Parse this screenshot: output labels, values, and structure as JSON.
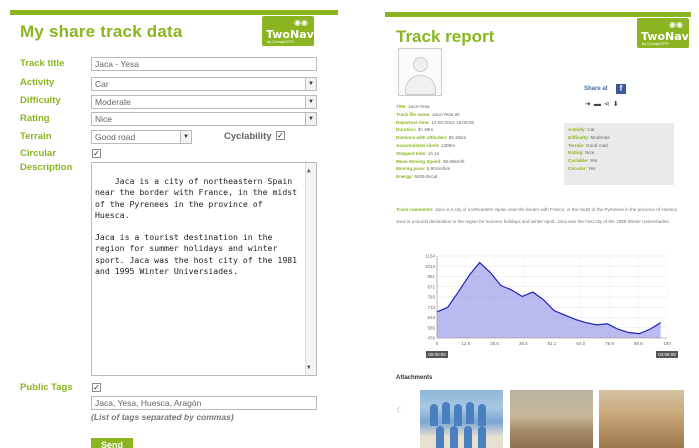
{
  "form": {
    "title": "My share track data",
    "logo": {
      "word": "TwoNav",
      "sub": "by CompeGPS"
    },
    "labels": {
      "track_title": "Track title",
      "activity": "Activity",
      "difficulty": "Difficulty",
      "rating": "Rating",
      "terrain": "Terrain",
      "circular": "Circular",
      "description": "Description",
      "public_tags": "Public Tags",
      "cyclability": "Cyclability"
    },
    "values": {
      "track_title": "Jaca - Yesa",
      "activity": "Car",
      "difficulty": "Moderate",
      "rating": "Nice",
      "terrain": "Good road",
      "description": "Jaca is a city of northeastern Spain near the border with France, in the midst of the Pyrenees in the province of Huesca.\n\nJaca is a tourist destination in the region for summer holidays and winter sport. Jaca was the host city of the 1981 and 1995 Winter Universiades.",
      "tags": "Jaca, Yesa, Huesca, Aragón"
    },
    "checkboxes": {
      "cyclability": true,
      "circular": true,
      "public_tags": true
    },
    "tags_hint": "(List of tags separated by commas)",
    "send_label": "Send"
  },
  "report": {
    "title": "Track report",
    "logo": {
      "word": "TwoNav",
      "sub": "by CompeGPS"
    },
    "share_label": "Share at",
    "icons": [
      "track-icon",
      "video-icon",
      "share-icon",
      "download-icon"
    ],
    "info": [
      {
        "k": "Title:",
        "v": "Jaca-Yesa"
      },
      {
        "k": "Track file name:",
        "v": "Jaca-Yesa.trk"
      },
      {
        "k": "Departure time:",
        "v": "12-03-2012 15:09:05"
      },
      {
        "k": "Duration:",
        "v": "3h 49m"
      },
      {
        "k": "Distance with altitudes:",
        "v": "98.15km"
      },
      {
        "k": "Accumulated climb:",
        "v": "1309m"
      },
      {
        "k": "Stopped time:",
        "v": "1h 1s"
      },
      {
        "k": "Mean Moving Speed:",
        "v": "65.59km/h"
      },
      {
        "k": "Moving pace:",
        "v": "5.90min/km"
      },
      {
        "k": "Energy:",
        "v": "5539.0Kcal"
      }
    ],
    "side_info": [
      {
        "k": "Activity:",
        "v": "Car"
      },
      {
        "k": "Difficulty:",
        "v": "Moderate"
      },
      {
        "k": "Terrain:",
        "v": "Good road"
      },
      {
        "k": "Rating:",
        "v": "Nice"
      },
      {
        "k": "Cyclable:",
        "v": "Yes"
      },
      {
        "k": "Circular:",
        "v": "Yes"
      }
    ],
    "comment_label": "Track comments:",
    "comment_1": "Jaca is a city of northeastern Spain near the border with France, in the midst of the Pyrenees in the province of Huesca.",
    "comment_2": "Jaca is a tourist destination in the region for summer holidays and winter sport. Jaca was the host city of the 1995 Winter Universiades.",
    "attachments_label": "Attachments"
  },
  "chart_data": {
    "type": "area",
    "title": "",
    "xlabel": "",
    "ylabel": "",
    "x": [
      0,
      5,
      10,
      15,
      20,
      25,
      30,
      35,
      40,
      45,
      50,
      55,
      60,
      65,
      70,
      75,
      80,
      85,
      90,
      95,
      100,
      105
    ],
    "y": [
      720,
      760,
      900,
      1050,
      1170,
      1080,
      960,
      920,
      860,
      900,
      830,
      730,
      690,
      650,
      620,
      600,
      610,
      560,
      530,
      520,
      560,
      620
    ],
    "ylim": [
      480,
      1230
    ],
    "xlim": [
      0,
      108
    ],
    "xticks": [
      "0",
      "12.8",
      "25.5",
      "38.5",
      "51.1",
      "64.0",
      "76.8",
      "89.6",
      "100"
    ],
    "yticks": [
      "1134",
      "1013",
      "951",
      "872",
      "793",
      "713",
      "634",
      "555",
      "476"
    ],
    "start_label": "00:00:00",
    "end_label": "04:06:08",
    "grid": true,
    "fill_color": "#8e8ee8",
    "line_color": "#1f22b4"
  }
}
